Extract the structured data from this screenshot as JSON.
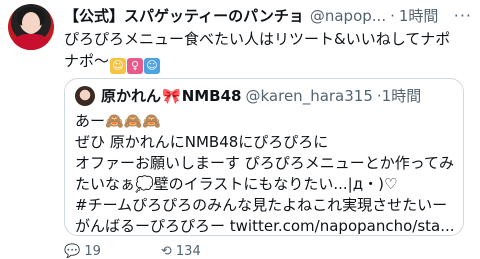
{
  "tweet": {
    "author_name": "【公式】スパゲッティーのパンチョ",
    "handle": "@napop...",
    "dot": "·",
    "time": "1時間",
    "more": "···",
    "text": "ぴろぴろメニュー食べたい人はリツート&いいねしてナポナポ〜",
    "emojis": [
      "man-gesturing-ok-emoji",
      "female-sign-emoji",
      "man-gesturing-ok-emoji"
    ]
  },
  "quoted": {
    "name": "原かれん",
    "name_suffix": "NMB48",
    "handle": "@karen_hara315",
    "dot": "·",
    "time": "1時間",
    "body": "あー🙈🙈🙈\nぜひ 原かれんにNMB48にぴろぴろに\nオファーお願いしまーす ぴろぴろメニューとか作ってみたいなぁ💭壁のイラストにもなりたい...|д・)♡\n#チームぴろぴろのみんな見たよねこれ実現させたいーがんばるーぴろぴろー twitter.com/napopancho/sta..."
  },
  "actions": {
    "reply_count": "19",
    "retweet_count": "134"
  }
}
